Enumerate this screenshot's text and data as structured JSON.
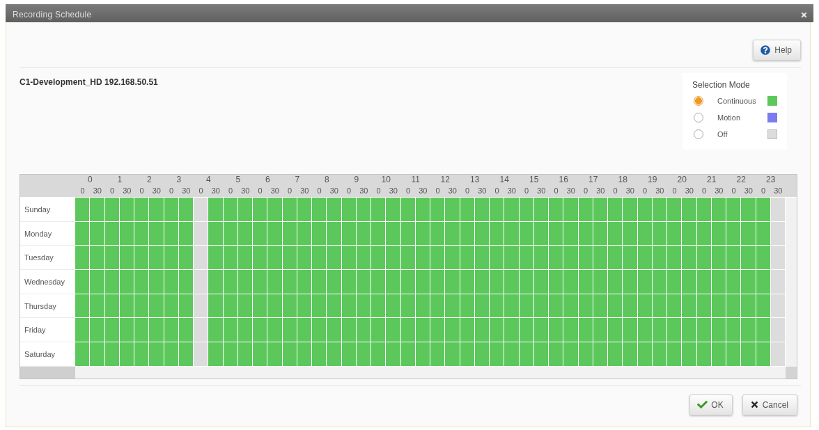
{
  "window": {
    "title": "Recording Schedule"
  },
  "toolbar": {
    "help_button": "Help"
  },
  "camera": {
    "label": "C1-Development_HD 192.168.50.51"
  },
  "selection_mode": {
    "title": "Selection Mode",
    "options": [
      {
        "kind": "continuous",
        "label": "Continuous",
        "selected": true,
        "color": "#5cc85c"
      },
      {
        "kind": "motion",
        "label": "Motion",
        "selected": false,
        "color": "#7b7bf0"
      },
      {
        "kind": "off",
        "label": "Off",
        "selected": false,
        "color": "#dcdcdc"
      }
    ]
  },
  "schedule": {
    "hours": [
      {
        "hour": "0",
        "halves": [
          "0",
          "30"
        ]
      },
      {
        "hour": "1",
        "halves": [
          "0",
          "30"
        ]
      },
      {
        "hour": "2",
        "halves": [
          "0",
          "30"
        ]
      },
      {
        "hour": "3",
        "halves": [
          "0",
          "30"
        ]
      },
      {
        "hour": "4",
        "halves": [
          "0",
          "30"
        ]
      },
      {
        "hour": "5",
        "halves": [
          "0",
          "30"
        ]
      },
      {
        "hour": "6",
        "halves": [
          "0",
          "30"
        ]
      },
      {
        "hour": "7",
        "halves": [
          "0",
          "30"
        ]
      },
      {
        "hour": "8",
        "halves": [
          "0",
          "30"
        ]
      },
      {
        "hour": "9",
        "halves": [
          "0",
          "30"
        ]
      },
      {
        "hour": "10",
        "halves": [
          "0",
          "30"
        ]
      },
      {
        "hour": "11",
        "halves": [
          "0",
          "30"
        ]
      },
      {
        "hour": "12",
        "halves": [
          "0",
          "30"
        ]
      },
      {
        "hour": "13",
        "halves": [
          "0",
          "30"
        ]
      },
      {
        "hour": "14",
        "halves": [
          "0",
          "30"
        ]
      },
      {
        "hour": "15",
        "halves": [
          "0",
          "30"
        ]
      },
      {
        "hour": "16",
        "halves": [
          "0",
          "30"
        ]
      },
      {
        "hour": "17",
        "halves": [
          "0",
          "30"
        ]
      },
      {
        "hour": "18",
        "halves": [
          "0",
          "30"
        ]
      },
      {
        "hour": "19",
        "halves": [
          "0",
          "30"
        ]
      },
      {
        "hour": "20",
        "halves": [
          "0",
          "30"
        ]
      },
      {
        "hour": "21",
        "halves": [
          "0",
          "30"
        ]
      },
      {
        "hour": "22",
        "halves": [
          "0",
          "30"
        ]
      },
      {
        "hour": "23",
        "halves": [
          "0",
          "30"
        ]
      }
    ],
    "rows": [
      {
        "day": "Sunday",
        "cells": [
          {
            "kind": "continuous"
          },
          {
            "kind": "continuous"
          },
          {
            "kind": "continuous"
          },
          {
            "kind": "continuous"
          },
          {
            "kind": "continuous"
          },
          {
            "kind": "continuous"
          },
          {
            "kind": "continuous"
          },
          {
            "kind": "continuous"
          },
          {
            "kind": "off"
          },
          {
            "kind": "continuous"
          },
          {
            "kind": "continuous"
          },
          {
            "kind": "continuous"
          },
          {
            "kind": "continuous"
          },
          {
            "kind": "continuous"
          },
          {
            "kind": "continuous"
          },
          {
            "kind": "continuous"
          },
          {
            "kind": "continuous"
          },
          {
            "kind": "continuous"
          },
          {
            "kind": "continuous"
          },
          {
            "kind": "continuous"
          },
          {
            "kind": "continuous"
          },
          {
            "kind": "continuous"
          },
          {
            "kind": "continuous"
          },
          {
            "kind": "continuous"
          },
          {
            "kind": "continuous"
          },
          {
            "kind": "continuous"
          },
          {
            "kind": "continuous"
          },
          {
            "kind": "continuous"
          },
          {
            "kind": "continuous"
          },
          {
            "kind": "continuous"
          },
          {
            "kind": "continuous"
          },
          {
            "kind": "continuous"
          },
          {
            "kind": "continuous"
          },
          {
            "kind": "continuous"
          },
          {
            "kind": "continuous"
          },
          {
            "kind": "continuous"
          },
          {
            "kind": "continuous"
          },
          {
            "kind": "continuous"
          },
          {
            "kind": "continuous"
          },
          {
            "kind": "continuous"
          },
          {
            "kind": "continuous"
          },
          {
            "kind": "continuous"
          },
          {
            "kind": "continuous"
          },
          {
            "kind": "continuous"
          },
          {
            "kind": "continuous"
          },
          {
            "kind": "continuous"
          },
          {
            "kind": "continuous"
          },
          {
            "kind": "off"
          }
        ]
      },
      {
        "day": "Monday",
        "cells": [
          {
            "kind": "continuous"
          },
          {
            "kind": "continuous"
          },
          {
            "kind": "continuous"
          },
          {
            "kind": "continuous"
          },
          {
            "kind": "continuous"
          },
          {
            "kind": "continuous"
          },
          {
            "kind": "continuous"
          },
          {
            "kind": "continuous"
          },
          {
            "kind": "off"
          },
          {
            "kind": "continuous"
          },
          {
            "kind": "continuous"
          },
          {
            "kind": "continuous"
          },
          {
            "kind": "continuous"
          },
          {
            "kind": "continuous"
          },
          {
            "kind": "continuous"
          },
          {
            "kind": "continuous"
          },
          {
            "kind": "continuous"
          },
          {
            "kind": "continuous"
          },
          {
            "kind": "continuous"
          },
          {
            "kind": "continuous"
          },
          {
            "kind": "continuous"
          },
          {
            "kind": "continuous"
          },
          {
            "kind": "continuous"
          },
          {
            "kind": "continuous"
          },
          {
            "kind": "continuous"
          },
          {
            "kind": "continuous"
          },
          {
            "kind": "continuous"
          },
          {
            "kind": "continuous"
          },
          {
            "kind": "continuous"
          },
          {
            "kind": "continuous"
          },
          {
            "kind": "continuous"
          },
          {
            "kind": "continuous"
          },
          {
            "kind": "continuous"
          },
          {
            "kind": "continuous"
          },
          {
            "kind": "continuous"
          },
          {
            "kind": "continuous"
          },
          {
            "kind": "continuous"
          },
          {
            "kind": "continuous"
          },
          {
            "kind": "continuous"
          },
          {
            "kind": "continuous"
          },
          {
            "kind": "continuous"
          },
          {
            "kind": "continuous"
          },
          {
            "kind": "continuous"
          },
          {
            "kind": "continuous"
          },
          {
            "kind": "continuous"
          },
          {
            "kind": "continuous"
          },
          {
            "kind": "continuous"
          },
          {
            "kind": "off"
          }
        ]
      },
      {
        "day": "Tuesday",
        "cells": [
          {
            "kind": "continuous"
          },
          {
            "kind": "continuous"
          },
          {
            "kind": "continuous"
          },
          {
            "kind": "continuous"
          },
          {
            "kind": "continuous"
          },
          {
            "kind": "continuous"
          },
          {
            "kind": "continuous"
          },
          {
            "kind": "continuous"
          },
          {
            "kind": "off"
          },
          {
            "kind": "continuous"
          },
          {
            "kind": "continuous"
          },
          {
            "kind": "continuous"
          },
          {
            "kind": "continuous"
          },
          {
            "kind": "continuous"
          },
          {
            "kind": "continuous"
          },
          {
            "kind": "continuous"
          },
          {
            "kind": "continuous"
          },
          {
            "kind": "continuous"
          },
          {
            "kind": "continuous"
          },
          {
            "kind": "continuous"
          },
          {
            "kind": "continuous"
          },
          {
            "kind": "continuous"
          },
          {
            "kind": "continuous"
          },
          {
            "kind": "continuous"
          },
          {
            "kind": "continuous"
          },
          {
            "kind": "continuous"
          },
          {
            "kind": "continuous"
          },
          {
            "kind": "continuous"
          },
          {
            "kind": "continuous"
          },
          {
            "kind": "continuous"
          },
          {
            "kind": "continuous"
          },
          {
            "kind": "continuous"
          },
          {
            "kind": "continuous"
          },
          {
            "kind": "continuous"
          },
          {
            "kind": "continuous"
          },
          {
            "kind": "continuous"
          },
          {
            "kind": "continuous"
          },
          {
            "kind": "continuous"
          },
          {
            "kind": "continuous"
          },
          {
            "kind": "continuous"
          },
          {
            "kind": "continuous"
          },
          {
            "kind": "continuous"
          },
          {
            "kind": "continuous"
          },
          {
            "kind": "continuous"
          },
          {
            "kind": "continuous"
          },
          {
            "kind": "continuous"
          },
          {
            "kind": "continuous"
          },
          {
            "kind": "off"
          }
        ]
      },
      {
        "day": "Wednesday",
        "cells": [
          {
            "kind": "continuous"
          },
          {
            "kind": "continuous"
          },
          {
            "kind": "continuous"
          },
          {
            "kind": "continuous"
          },
          {
            "kind": "continuous"
          },
          {
            "kind": "continuous"
          },
          {
            "kind": "continuous"
          },
          {
            "kind": "continuous"
          },
          {
            "kind": "off"
          },
          {
            "kind": "continuous"
          },
          {
            "kind": "continuous"
          },
          {
            "kind": "continuous"
          },
          {
            "kind": "continuous"
          },
          {
            "kind": "continuous"
          },
          {
            "kind": "continuous"
          },
          {
            "kind": "continuous"
          },
          {
            "kind": "continuous"
          },
          {
            "kind": "continuous"
          },
          {
            "kind": "continuous"
          },
          {
            "kind": "continuous"
          },
          {
            "kind": "continuous"
          },
          {
            "kind": "continuous"
          },
          {
            "kind": "continuous"
          },
          {
            "kind": "continuous"
          },
          {
            "kind": "continuous"
          },
          {
            "kind": "continuous"
          },
          {
            "kind": "continuous"
          },
          {
            "kind": "continuous"
          },
          {
            "kind": "continuous"
          },
          {
            "kind": "continuous"
          },
          {
            "kind": "continuous"
          },
          {
            "kind": "continuous"
          },
          {
            "kind": "continuous"
          },
          {
            "kind": "continuous"
          },
          {
            "kind": "continuous"
          },
          {
            "kind": "continuous"
          },
          {
            "kind": "continuous"
          },
          {
            "kind": "continuous"
          },
          {
            "kind": "continuous"
          },
          {
            "kind": "continuous"
          },
          {
            "kind": "continuous"
          },
          {
            "kind": "continuous"
          },
          {
            "kind": "continuous"
          },
          {
            "kind": "continuous"
          },
          {
            "kind": "continuous"
          },
          {
            "kind": "continuous"
          },
          {
            "kind": "continuous"
          },
          {
            "kind": "off"
          }
        ]
      },
      {
        "day": "Thursday",
        "cells": [
          {
            "kind": "continuous"
          },
          {
            "kind": "continuous"
          },
          {
            "kind": "continuous"
          },
          {
            "kind": "continuous"
          },
          {
            "kind": "continuous"
          },
          {
            "kind": "continuous"
          },
          {
            "kind": "continuous"
          },
          {
            "kind": "continuous"
          },
          {
            "kind": "off"
          },
          {
            "kind": "continuous"
          },
          {
            "kind": "continuous"
          },
          {
            "kind": "continuous"
          },
          {
            "kind": "continuous"
          },
          {
            "kind": "continuous"
          },
          {
            "kind": "continuous"
          },
          {
            "kind": "continuous"
          },
          {
            "kind": "continuous"
          },
          {
            "kind": "continuous"
          },
          {
            "kind": "continuous"
          },
          {
            "kind": "continuous"
          },
          {
            "kind": "continuous"
          },
          {
            "kind": "continuous"
          },
          {
            "kind": "continuous"
          },
          {
            "kind": "continuous"
          },
          {
            "kind": "continuous"
          },
          {
            "kind": "continuous"
          },
          {
            "kind": "continuous"
          },
          {
            "kind": "continuous"
          },
          {
            "kind": "continuous"
          },
          {
            "kind": "continuous"
          },
          {
            "kind": "continuous"
          },
          {
            "kind": "continuous"
          },
          {
            "kind": "continuous"
          },
          {
            "kind": "continuous"
          },
          {
            "kind": "continuous"
          },
          {
            "kind": "continuous"
          },
          {
            "kind": "continuous"
          },
          {
            "kind": "continuous"
          },
          {
            "kind": "continuous"
          },
          {
            "kind": "continuous"
          },
          {
            "kind": "continuous"
          },
          {
            "kind": "continuous"
          },
          {
            "kind": "continuous"
          },
          {
            "kind": "continuous"
          },
          {
            "kind": "continuous"
          },
          {
            "kind": "continuous"
          },
          {
            "kind": "continuous"
          },
          {
            "kind": "off"
          }
        ]
      },
      {
        "day": "Friday",
        "cells": [
          {
            "kind": "continuous"
          },
          {
            "kind": "continuous"
          },
          {
            "kind": "continuous"
          },
          {
            "kind": "continuous"
          },
          {
            "kind": "continuous"
          },
          {
            "kind": "continuous"
          },
          {
            "kind": "continuous"
          },
          {
            "kind": "continuous"
          },
          {
            "kind": "off"
          },
          {
            "kind": "continuous"
          },
          {
            "kind": "continuous"
          },
          {
            "kind": "continuous"
          },
          {
            "kind": "continuous"
          },
          {
            "kind": "continuous"
          },
          {
            "kind": "continuous"
          },
          {
            "kind": "continuous"
          },
          {
            "kind": "continuous"
          },
          {
            "kind": "continuous"
          },
          {
            "kind": "continuous"
          },
          {
            "kind": "continuous"
          },
          {
            "kind": "continuous"
          },
          {
            "kind": "continuous"
          },
          {
            "kind": "continuous"
          },
          {
            "kind": "continuous"
          },
          {
            "kind": "continuous"
          },
          {
            "kind": "continuous"
          },
          {
            "kind": "continuous"
          },
          {
            "kind": "continuous"
          },
          {
            "kind": "continuous"
          },
          {
            "kind": "continuous"
          },
          {
            "kind": "continuous"
          },
          {
            "kind": "continuous"
          },
          {
            "kind": "continuous"
          },
          {
            "kind": "continuous"
          },
          {
            "kind": "continuous"
          },
          {
            "kind": "continuous"
          },
          {
            "kind": "continuous"
          },
          {
            "kind": "continuous"
          },
          {
            "kind": "continuous"
          },
          {
            "kind": "continuous"
          },
          {
            "kind": "continuous"
          },
          {
            "kind": "continuous"
          },
          {
            "kind": "continuous"
          },
          {
            "kind": "continuous"
          },
          {
            "kind": "continuous"
          },
          {
            "kind": "continuous"
          },
          {
            "kind": "continuous"
          },
          {
            "kind": "off"
          }
        ]
      },
      {
        "day": "Saturday",
        "cells": [
          {
            "kind": "continuous"
          },
          {
            "kind": "continuous"
          },
          {
            "kind": "continuous"
          },
          {
            "kind": "continuous"
          },
          {
            "kind": "continuous"
          },
          {
            "kind": "continuous"
          },
          {
            "kind": "continuous"
          },
          {
            "kind": "continuous"
          },
          {
            "kind": "off"
          },
          {
            "kind": "continuous"
          },
          {
            "kind": "continuous"
          },
          {
            "kind": "continuous"
          },
          {
            "kind": "continuous"
          },
          {
            "kind": "continuous"
          },
          {
            "kind": "continuous"
          },
          {
            "kind": "continuous"
          },
          {
            "kind": "continuous"
          },
          {
            "kind": "continuous"
          },
          {
            "kind": "continuous"
          },
          {
            "kind": "continuous"
          },
          {
            "kind": "continuous"
          },
          {
            "kind": "continuous"
          },
          {
            "kind": "continuous"
          },
          {
            "kind": "continuous"
          },
          {
            "kind": "continuous"
          },
          {
            "kind": "continuous"
          },
          {
            "kind": "continuous"
          },
          {
            "kind": "continuous"
          },
          {
            "kind": "continuous"
          },
          {
            "kind": "continuous"
          },
          {
            "kind": "continuous"
          },
          {
            "kind": "continuous"
          },
          {
            "kind": "continuous"
          },
          {
            "kind": "continuous"
          },
          {
            "kind": "continuous"
          },
          {
            "kind": "continuous"
          },
          {
            "kind": "continuous"
          },
          {
            "kind": "continuous"
          },
          {
            "kind": "continuous"
          },
          {
            "kind": "continuous"
          },
          {
            "kind": "continuous"
          },
          {
            "kind": "continuous"
          },
          {
            "kind": "continuous"
          },
          {
            "kind": "continuous"
          },
          {
            "kind": "continuous"
          },
          {
            "kind": "continuous"
          },
          {
            "kind": "continuous"
          },
          {
            "kind": "off"
          }
        ]
      }
    ]
  },
  "buttons": [
    {
      "kind": "ok",
      "label": "OK"
    },
    {
      "kind": "cancel",
      "label": "Cancel"
    }
  ]
}
